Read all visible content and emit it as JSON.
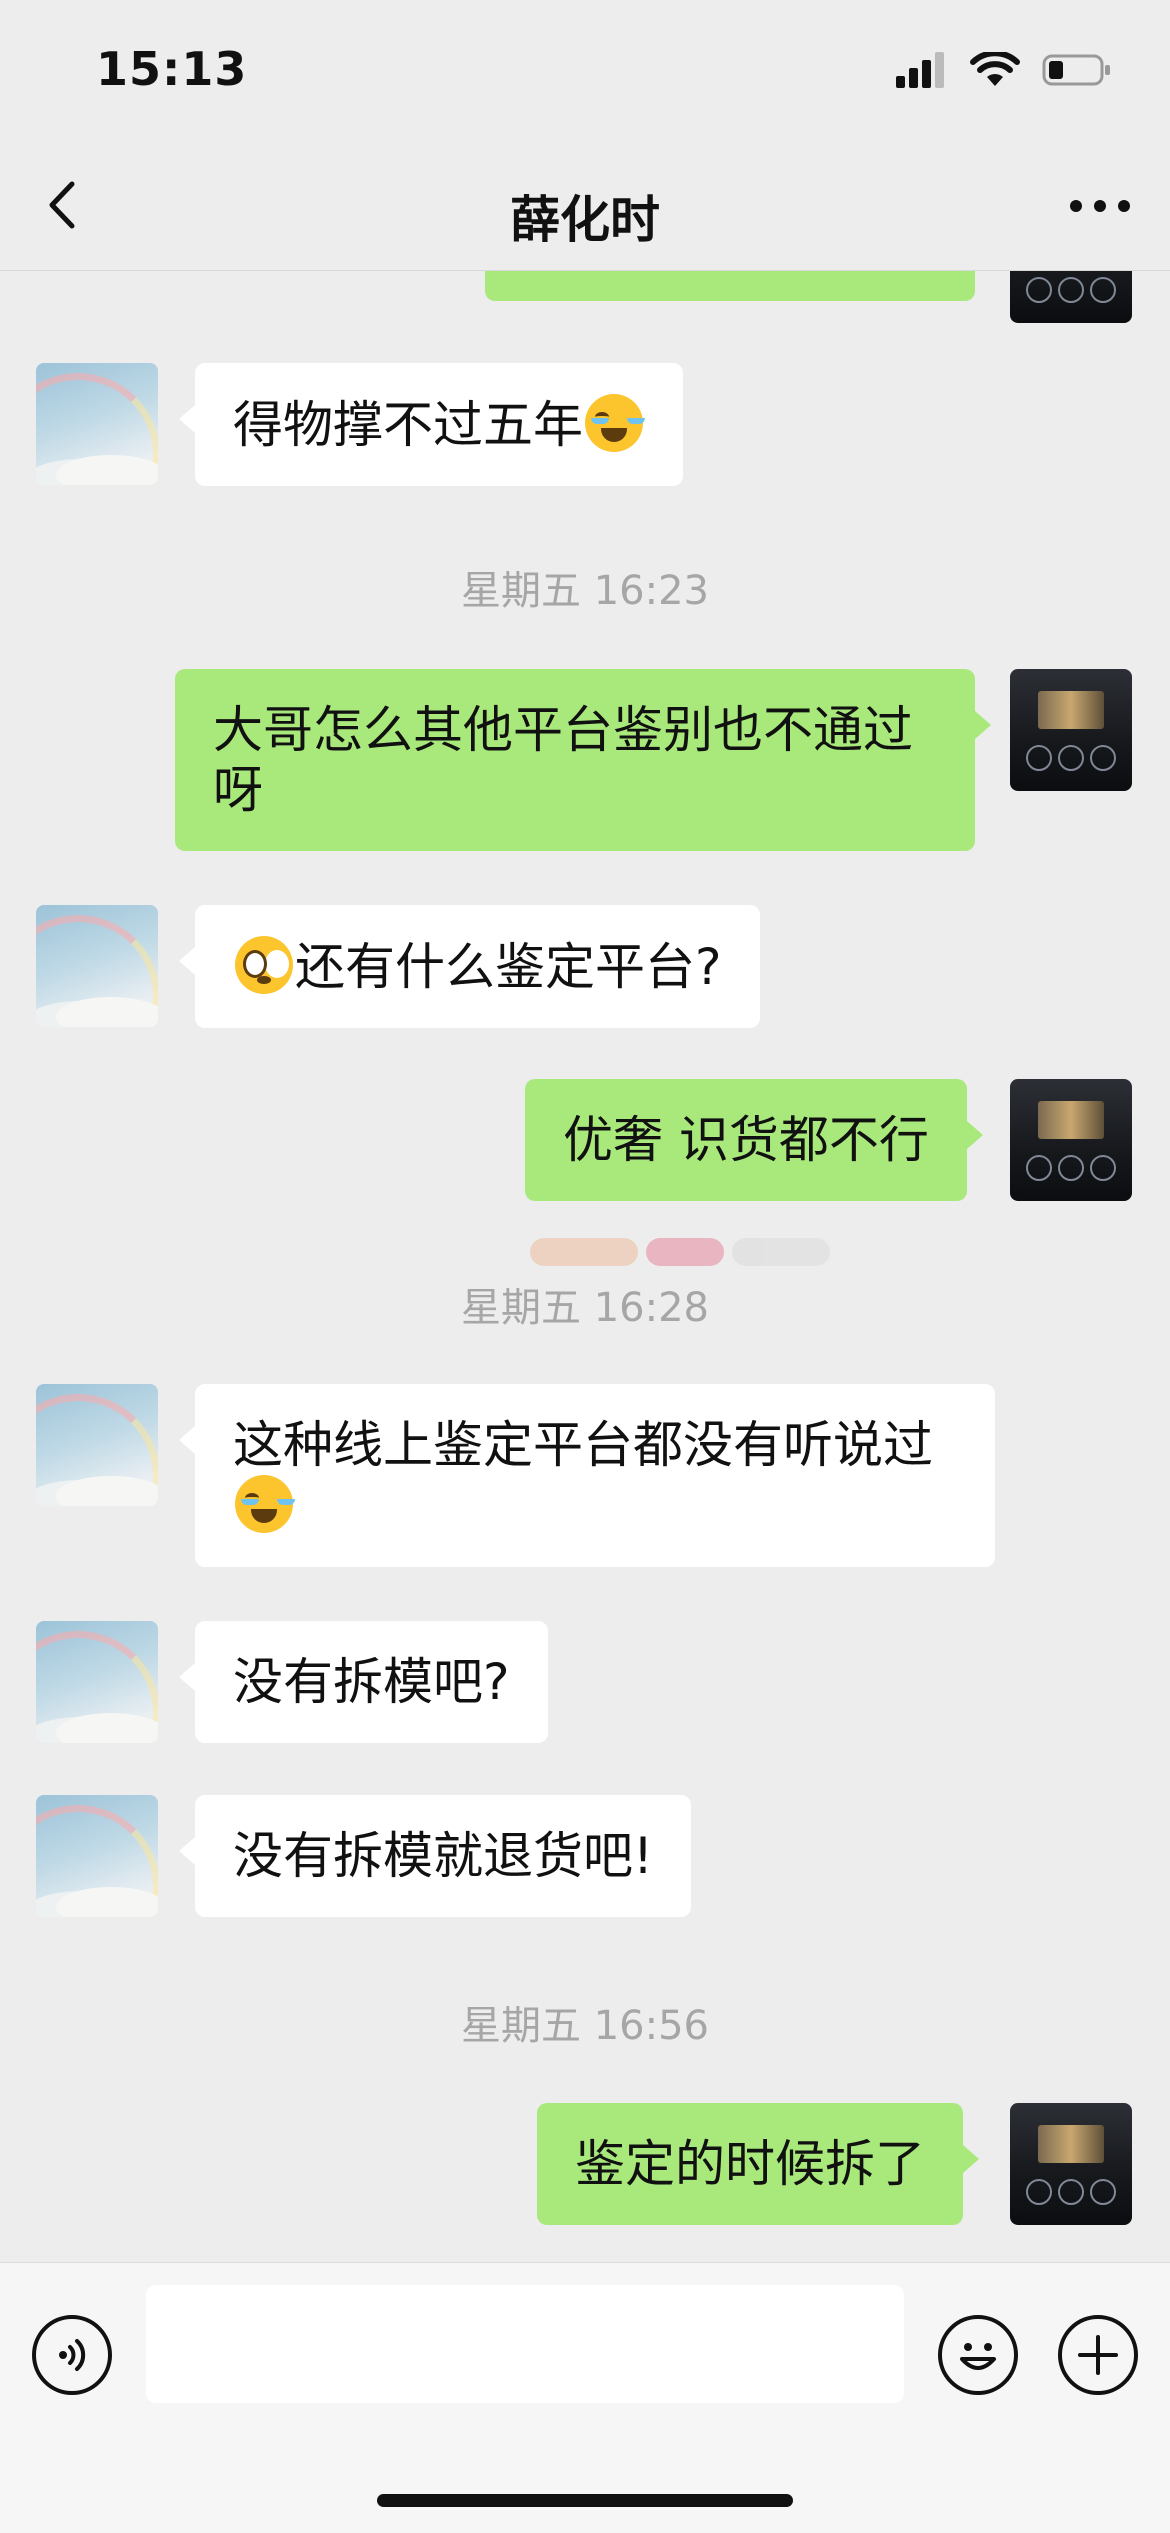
{
  "status": {
    "time": "15:13"
  },
  "header": {
    "title": "薛化时"
  },
  "messages": [
    {
      "type": "in",
      "text": "得物撑不过五年",
      "emoji": "cry"
    },
    {
      "type": "time",
      "text": "星期五 16:23"
    },
    {
      "type": "out",
      "text": "大哥怎么其他平台鉴别也不通过呀"
    },
    {
      "type": "in",
      "text": "还有什么鉴定平台?",
      "emoji_before": "stare"
    },
    {
      "type": "out",
      "text": "优奢 识货都不行"
    },
    {
      "type": "time",
      "text": "星期五 16:28"
    },
    {
      "type": "in",
      "text": "这种线上鉴定平台都没有听说过",
      "emoji": "cry"
    },
    {
      "type": "in",
      "text": "没有拆模吧?"
    },
    {
      "type": "in",
      "text": "没有拆模就退货吧!"
    },
    {
      "type": "time",
      "text": "星期五 16:56"
    },
    {
      "type": "out",
      "text": "鉴定的时候拆了"
    }
  ],
  "icons": {
    "back": "chevron-left-icon",
    "more": "more-dots-icon",
    "voice": "voice-icon",
    "emoji": "emoji-icon",
    "plus": "plus-icon"
  },
  "colors": {
    "outgoing_bubble": "#a9e97c",
    "incoming_bubble": "#ffffff",
    "background": "#ededed"
  }
}
